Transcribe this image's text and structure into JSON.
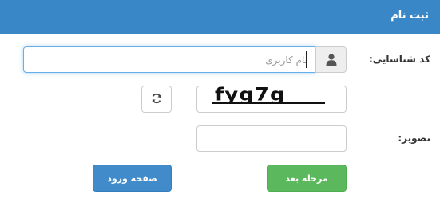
{
  "header": {
    "title": "ثبت نام"
  },
  "form": {
    "id_label": "کد شناسایی:",
    "username_placeholder": "نام کاربری",
    "username_value": "",
    "captcha_text": "fyg7g",
    "image_label": "تصویر:",
    "image_value": ""
  },
  "buttons": {
    "next_label": "مرحله بعد",
    "login_label": "صفحه ورود"
  },
  "icons": {
    "user": "user-icon",
    "refresh": "refresh-icon"
  },
  "colors": {
    "header": "#3a87c8",
    "next_button": "#5cb85c",
    "login_button": "#428bca"
  }
}
